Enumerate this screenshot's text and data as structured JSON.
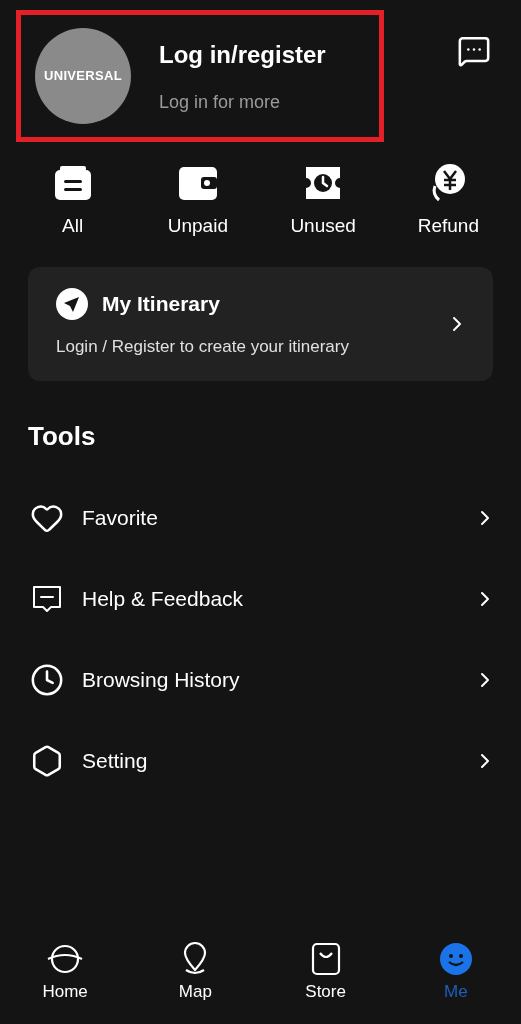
{
  "profile": {
    "logo_text": "UNIVERSAL",
    "title": "Log in/register",
    "subtitle": "Log in for more",
    "highlighted": true
  },
  "orders": [
    {
      "label": "All"
    },
    {
      "label": "Unpaid"
    },
    {
      "label": "Unused"
    },
    {
      "label": "Refund"
    }
  ],
  "itinerary": {
    "title": "My Itinerary",
    "text": "Login / Register to create your itinerary"
  },
  "tools": {
    "heading": "Tools",
    "items": [
      {
        "label": "Favorite"
      },
      {
        "label": "Help & Feedback"
      },
      {
        "label": "Browsing History"
      },
      {
        "label": "Setting"
      }
    ]
  },
  "nav": [
    {
      "label": "Home",
      "selected": false
    },
    {
      "label": "Map",
      "selected": false
    },
    {
      "label": "Store",
      "selected": false
    },
    {
      "label": "Me",
      "selected": true
    }
  ]
}
